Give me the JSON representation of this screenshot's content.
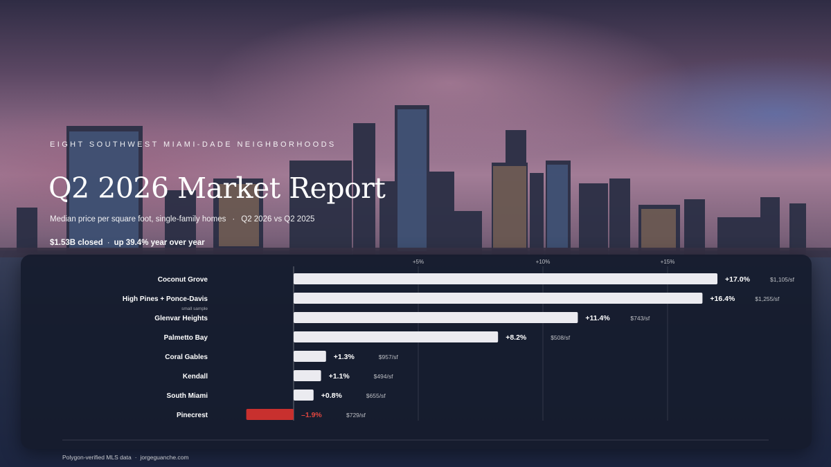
{
  "header": {
    "kicker": "EIGHT SOUTHWEST MIAMI-DADE NEIGHBORHOODS",
    "title": "Q2 2026 Market Report",
    "subtitle_metric": "Median price per square foot, single-family homes",
    "subtitle_period": "Q2 2026 vs Q2 2025",
    "stat_closed": "$1.53B closed",
    "stat_growth": "up 39.4% year over year",
    "separator": "·"
  },
  "chart_data": {
    "type": "bar",
    "orientation": "horizontal",
    "x_unit": "% change",
    "xlim": [
      -4,
      17
    ],
    "x_ticks": [
      {
        "value": 5,
        "label": "+5%"
      },
      {
        "value": 10,
        "label": "+10%"
      },
      {
        "value": 15,
        "label": "+15%"
      }
    ],
    "grid": true,
    "categories": [
      "Coconut Grove",
      "High Pines + Ponce-Davis",
      "Glenvar Heights",
      "Palmetto Bay",
      "Coral Gables",
      "Kendall",
      "South Miami",
      "Pinecrest"
    ],
    "values": [
      17.0,
      16.4,
      11.4,
      8.2,
      1.3,
      1.1,
      0.8,
      -1.9
    ],
    "value_labels": [
      "+17.0%",
      "+16.4%",
      "+11.4%",
      "+8.2%",
      "+1.3%",
      "+1.1%",
      "+0.8%",
      "–1.9%"
    ],
    "price_labels": [
      "$1,105/sf",
      "$1,255/sf",
      "$743/sf",
      "$508/sf",
      "$957/sf",
      "$494/sf",
      "$655/sf",
      "$729/sf"
    ],
    "notes": [
      "",
      "small sample",
      "",
      "",
      "",
      "",
      "",
      ""
    ],
    "colors": {
      "positive": "#ebebf0",
      "negative": "#c8302e",
      "negative_text": "#e0463f"
    }
  },
  "footer": {
    "source": "Polygon-verified MLS data",
    "site": "jorgeguanche.com",
    "separator": "·"
  }
}
